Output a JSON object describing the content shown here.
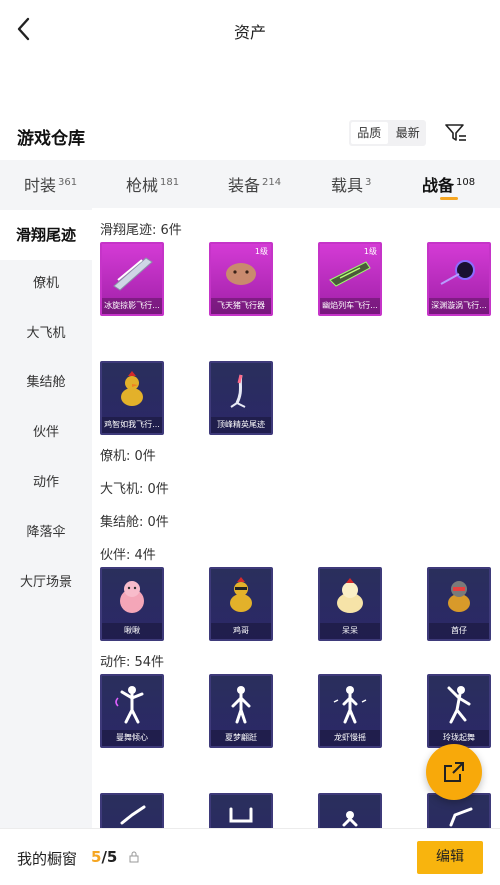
{
  "header": {
    "title": "资产"
  },
  "repo": {
    "title": "游戏仓库",
    "sort_quality": "品质",
    "sort_latest": "最新"
  },
  "tabs": [
    {
      "label": "时装",
      "count": "361"
    },
    {
      "label": "枪械",
      "count": "181"
    },
    {
      "label": "装备",
      "count": "214"
    },
    {
      "label": "载具",
      "count": "3"
    },
    {
      "label": "战备",
      "count": "108"
    }
  ],
  "sidebar": {
    "items": [
      {
        "label": "滑翔尾迹"
      },
      {
        "label": "僚机"
      },
      {
        "label": "大飞机"
      },
      {
        "label": "集结舱"
      },
      {
        "label": "伙伴"
      },
      {
        "label": "动作"
      },
      {
        "label": "降落伞"
      },
      {
        "label": "大厅场景"
      }
    ]
  },
  "sections": {
    "glide": "滑翔尾迹: 6件",
    "wingman": "僚机: 0件",
    "bigplane": "大飞机: 0件",
    "pod": "集结舱: 0件",
    "partner": "伙伴: 4件",
    "action": "动作: 54件"
  },
  "items": {
    "glide": [
      {
        "name": "冰旋掠影飞行...",
        "level": ""
      },
      {
        "name": "飞天猪飞行器",
        "level": "1级"
      },
      {
        "name": "幽焰列车飞行...",
        "level": "1级"
      },
      {
        "name": "深渊漩涡飞行...",
        "level": ""
      },
      {
        "name": "鸡智如我飞行...",
        "level": ""
      },
      {
        "name": "顶峰精英尾迹",
        "level": ""
      }
    ],
    "partner": [
      {
        "name": "啾啾"
      },
      {
        "name": "鸡哥"
      },
      {
        "name": "呆呆"
      },
      {
        "name": "酋仔"
      }
    ],
    "action": [
      {
        "name": "曼舞倾心"
      },
      {
        "name": "夏梦翩跹"
      },
      {
        "name": "龙虾慢摇"
      },
      {
        "name": "玲珑起舞"
      }
    ]
  },
  "bottom": {
    "label": "我的橱窗",
    "current": "5",
    "total": "/5",
    "edit": "编辑"
  },
  "colors": {
    "accent": "#f8b40e",
    "purple_card": "#c534c8",
    "navy_card": "#2b2768"
  }
}
